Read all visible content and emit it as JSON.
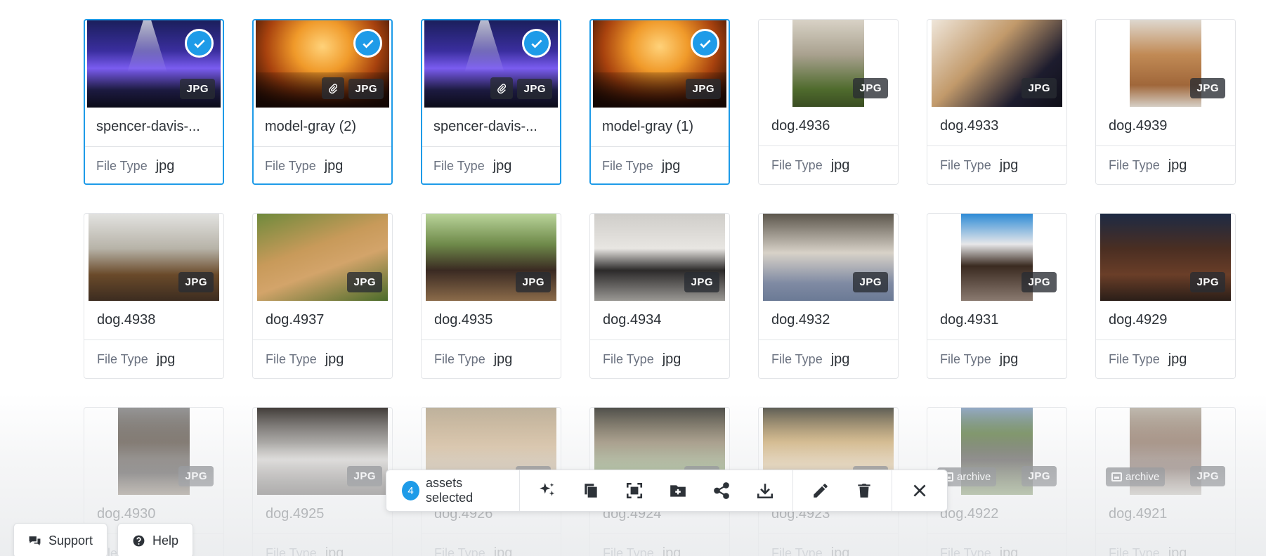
{
  "assets": [
    {
      "name": "spencer-davis-...",
      "type_label": "File Type",
      "type": "jpg",
      "badge": "JPG",
      "selected": true,
      "photo": "concert1",
      "attachment": false
    },
    {
      "name": "model-gray (2)",
      "type_label": "File Type",
      "type": "jpg",
      "badge": "JPG",
      "selected": true,
      "photo": "concert2",
      "attachment": true
    },
    {
      "name": "spencer-davis-...",
      "type_label": "File Type",
      "type": "jpg",
      "badge": "JPG",
      "selected": true,
      "photo": "concert1",
      "attachment": true
    },
    {
      "name": "model-gray (1)",
      "type_label": "File Type",
      "type": "jpg",
      "badge": "JPG",
      "selected": true,
      "photo": "concert2",
      "attachment": false
    },
    {
      "name": "dog.4936",
      "type_label": "File Type",
      "type": "jpg",
      "badge": "JPG",
      "selected": false,
      "photo": "d1"
    },
    {
      "name": "dog.4933",
      "type_label": "File Type",
      "type": "jpg",
      "badge": "JPG",
      "selected": false,
      "photo": "d2",
      "wide": true
    },
    {
      "name": "dog.4939",
      "type_label": "File Type",
      "type": "jpg",
      "badge": "JPG",
      "selected": false,
      "photo": "d3"
    },
    {
      "name": "dog.4938",
      "type_label": "File Type",
      "type": "jpg",
      "badge": "JPG",
      "selected": false,
      "photo": "d4",
      "wide": true
    },
    {
      "name": "dog.4937",
      "type_label": "File Type",
      "type": "jpg",
      "badge": "JPG",
      "selected": false,
      "photo": "d5",
      "wide": true
    },
    {
      "name": "dog.4935",
      "type_label": "File Type",
      "type": "jpg",
      "badge": "JPG",
      "selected": false,
      "photo": "d6",
      "wide": true
    },
    {
      "name": "dog.4934",
      "type_label": "File Type",
      "type": "jpg",
      "badge": "JPG",
      "selected": false,
      "photo": "d7",
      "wide": true
    },
    {
      "name": "dog.4932",
      "type_label": "File Type",
      "type": "jpg",
      "badge": "JPG",
      "selected": false,
      "photo": "d8",
      "wide": true
    },
    {
      "name": "dog.4931",
      "type_label": "File Type",
      "type": "jpg",
      "badge": "JPG",
      "selected": false,
      "photo": "d9"
    },
    {
      "name": "dog.4929",
      "type_label": "File Type",
      "type": "jpg",
      "badge": "JPG",
      "selected": false,
      "photo": "d10",
      "wide": true
    },
    {
      "name": "dog.4930",
      "type_label": "File Type",
      "type": "jpg",
      "badge": "JPG",
      "selected": false,
      "photo": "d11"
    },
    {
      "name": "dog.4925",
      "type_label": "File Type",
      "type": "jpg",
      "badge": "JPG",
      "selected": false,
      "photo": "d12",
      "wide": true
    },
    {
      "name": "dog.4926",
      "type_label": "File Type",
      "type": "jpg",
      "badge": "JPG",
      "selected": false,
      "photo": "d13",
      "wide": true
    },
    {
      "name": "dog.4924",
      "type_label": "File Type",
      "type": "jpg",
      "badge": "JPG",
      "selected": false,
      "photo": "d14",
      "wide": true
    },
    {
      "name": "dog.4923",
      "type_label": "File Type",
      "type": "jpg",
      "badge": "JPG",
      "selected": false,
      "photo": "d15",
      "wide": true
    },
    {
      "name": "dog.4922",
      "type_label": "File Type",
      "type": "jpg",
      "badge": "JPG",
      "selected": false,
      "photo": "d16",
      "archive": "archive"
    },
    {
      "name": "dog.4921",
      "type_label": "File Type",
      "type": "jpg",
      "badge": "JPG",
      "selected": false,
      "photo": "d17",
      "archive": "archive"
    }
  ],
  "action_bar": {
    "count": "4",
    "label": "assets selected",
    "icons": [
      "sparkles-icon",
      "copy-icon",
      "crop-icon",
      "add-to-folder-icon",
      "share-icon",
      "download-icon",
      "edit-icon",
      "delete-icon",
      "close-icon"
    ]
  },
  "support": {
    "label": "Support",
    "icon": "chat-icon"
  },
  "help": {
    "label": "Help",
    "icon": "question-circle-icon"
  },
  "colors": {
    "accent": "#1e9be8",
    "border": "#e3e5e8",
    "text": "#2d3238",
    "muted": "#6b7280"
  }
}
